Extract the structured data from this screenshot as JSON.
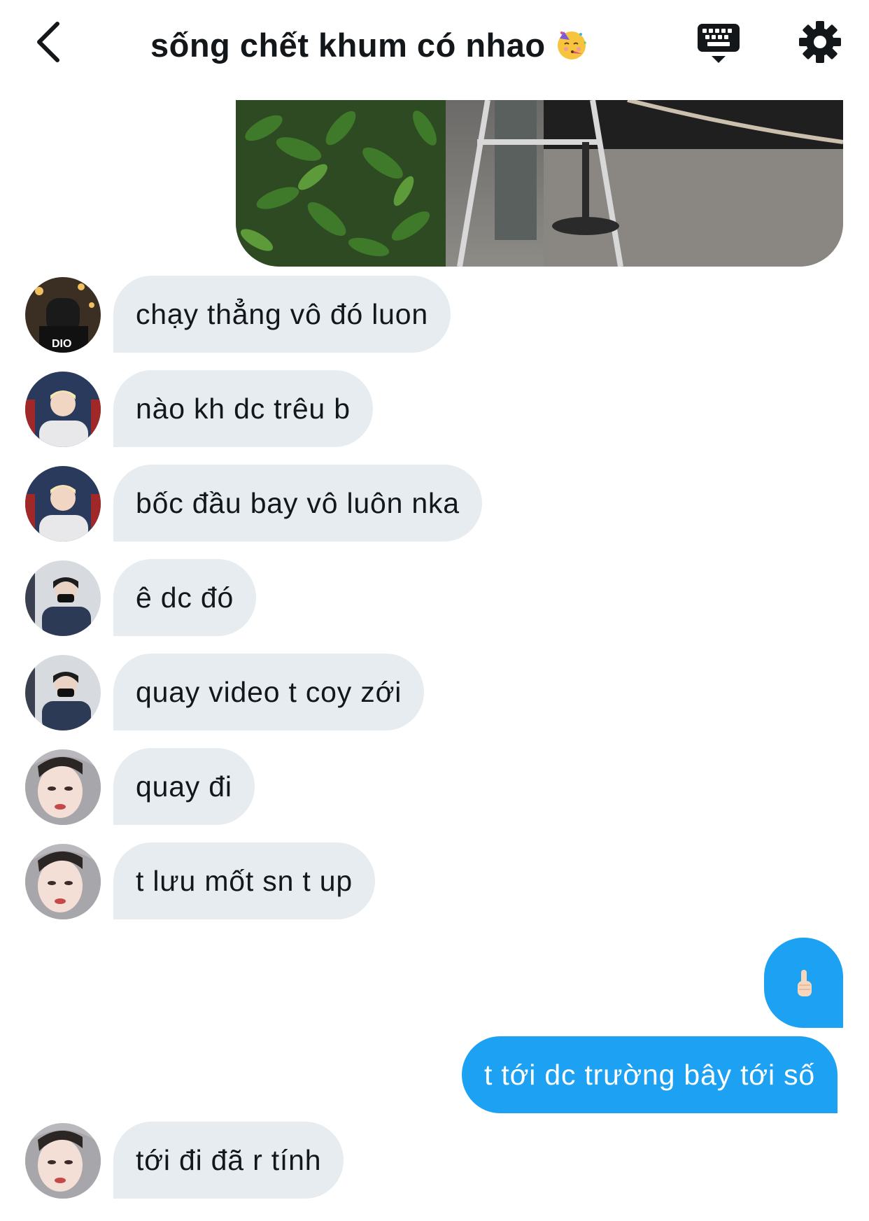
{
  "header": {
    "title": "sống chết khum có nhao",
    "title_emoji": "partying-face-emoji",
    "back_icon": "chevron-left-icon",
    "keyboard_icon": "keyboard-icon",
    "settings_icon": "gear-icon"
  },
  "colors": {
    "incoming_bubble": "#e6ecf0",
    "outgoing_bubble": "#1da1f2",
    "text": "#14171a"
  },
  "messages": [
    {
      "direction": "in",
      "text": "chạy thẳng vô đó luon",
      "avatar": "avatar-user-a"
    },
    {
      "direction": "in",
      "text": "nào kh dc trêu b",
      "avatar": "avatar-user-b"
    },
    {
      "direction": "in",
      "text": "bốc đầu bay vô luôn nka",
      "avatar": "avatar-user-b"
    },
    {
      "direction": "in",
      "text": "ê dc đó",
      "avatar": "avatar-user-c"
    },
    {
      "direction": "in",
      "text": "quay video t coy zới",
      "avatar": "avatar-user-c"
    },
    {
      "direction": "in",
      "text": "quay đi",
      "avatar": "avatar-user-d"
    },
    {
      "direction": "in",
      "text": "t lưu mốt sn t up",
      "avatar": "avatar-user-d"
    },
    {
      "direction": "out",
      "text": "",
      "emoji": "pointing-up-hand-emoji"
    },
    {
      "direction": "out",
      "text": "t tới dc trường bây tới số"
    },
    {
      "direction": "in",
      "text": "tới đi đã r tính",
      "avatar": "avatar-user-d"
    }
  ]
}
